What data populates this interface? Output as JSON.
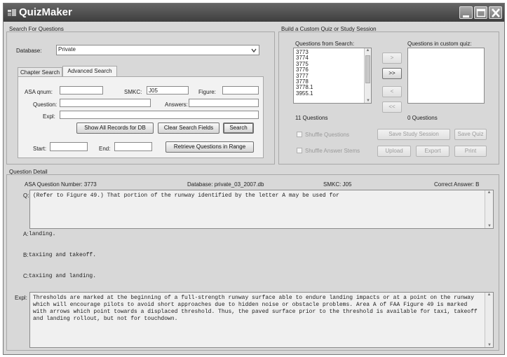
{
  "window": {
    "title": "QuizMaker"
  },
  "search": {
    "group_label": "Search For Questions",
    "database_label": "Database:",
    "database_value": "Private",
    "tabs": [
      "Chapter Search",
      "Advanced Search"
    ],
    "asa_qnum_label": "ASA qnum:",
    "asa_qnum_value": "",
    "smkc_label": "SMKC:",
    "smkc_value": "J05",
    "figure_label": "Figure:",
    "figure_value": "",
    "question_label": "Question:",
    "question_value": "",
    "answers_label": "Answers:",
    "answers_value": "",
    "expl_label": "Expl:",
    "expl_value": "",
    "show_all_label": "Show All Records for DB",
    "clear_label": "Clear Search Fields",
    "search_label": "Search",
    "start_label": "Start:",
    "start_value": "",
    "end_label": "End:",
    "end_value": "",
    "retrieve_label": "Retrieve Questions in Range"
  },
  "builder": {
    "group_label": "Build a Custom Quiz or Study Session",
    "from_search_label": "Questions from Search:",
    "in_quiz_label": "Questions in custom quiz:",
    "search_items": [
      "3773",
      "3774",
      "3775",
      "3776",
      "3777",
      "3778",
      "3778.1",
      "3955.1"
    ],
    "add_label": ">",
    "add_all_label": ">>",
    "remove_label": "<",
    "remove_all_label": "<<",
    "search_count": "11 Questions",
    "quiz_count": "0 Questions",
    "shuffle_questions_label": "Shuffle Questions",
    "shuffle_answers_label": "Shuffle Answer Stems",
    "save_study_label": "Save Study Session",
    "save_quiz_label": "Save Quiz",
    "upload_label": "Upload",
    "export_label": "Export",
    "print_label": "Print"
  },
  "detail": {
    "group_label": "Question Detail",
    "asa_number": "ASA Question Number: 3773",
    "database": "Database: private_03_2007.db",
    "smkc": "SMKC: J05",
    "correct": "Correct Answer: B",
    "q_label": "Q:",
    "question_text": "(Refer to Figure 49.) That portion of the runway identified by the letter A may be used for",
    "a_label": "A:",
    "answer_a": "landing.",
    "b_label": "B:",
    "answer_b": "taxiing and takeoff.",
    "c_label": "C:",
    "answer_c": "taxiing and landing.",
    "expl_label": "Expl:",
    "expl_line_1": "Thresholds are marked at the beginning of a full-strength runway surface able to endure landing impacts or at a point on the runway",
    "expl_line_2": "which will encourage pilots to avoid short approaches due to hidden noise or obstacle problems. Area A of FAA Figure 49 is marked",
    "expl_line_3": "with arrows which point towards a displaced threshold. Thus, the paved surface prior to the threshold is available for taxi, takeoff",
    "expl_line_4": "and landing rollout, but not for touchdown."
  },
  "icons": {
    "app": "quizmaker-app-icon",
    "minimize": "minimize-icon",
    "maximize": "maximize-icon",
    "close": "close-icon",
    "dropdown": "chevron-down-icon"
  }
}
